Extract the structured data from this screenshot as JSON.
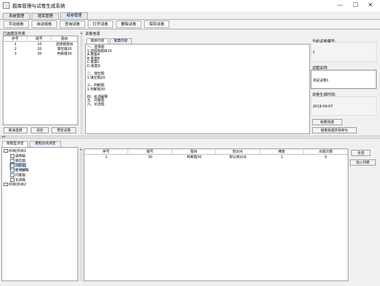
{
  "window": {
    "title": "题库管理与试卷生成系统",
    "minimize": "—",
    "maximize": "☐",
    "close": "✕"
  },
  "tabs": [
    "系统管理",
    "题库管理",
    "组卷管理"
  ],
  "toolbar": [
    "手动组卷",
    "自动组卷",
    "查询试卷",
    "打开试卷",
    "删除试卷",
    "保存试卷"
  ],
  "selected_panel": {
    "title": "已选题目列表",
    "headers": [
      "序号",
      "题号",
      "题目"
    ],
    "rows": [
      [
        "1",
        "10",
        "选择题题目"
      ],
      [
        "2",
        "20",
        "填空题20"
      ],
      [
        "3",
        "30",
        "判断题30"
      ]
    ],
    "buttons": [
      "取消选择",
      "清空",
      "预览试卷"
    ]
  },
  "paper_info": {
    "title": "试卷信息",
    "subtabs": [
      "题目内容",
      "答案内容"
    ],
    "content": [
      "一、选择题",
      "1.选择题题目10",
      "A.答案A",
      "B.答案B",
      "C.答案C",
      "D.答案D",
      "",
      "二、填空题",
      "1.填空题20",
      "",
      "三、判断题",
      "1.判断题30",
      "",
      "四、名词解释",
      "五、问答题",
      "六、论述题"
    ],
    "number_label": "当前试卷编号:",
    "number_value": "1",
    "name_label": "试题名称:",
    "name_value": "测试试卷1",
    "time_label": "试卷生成时间:",
    "time_value": "2019-09-07",
    "btn_complete": "组卷完成",
    "btn_complete_save": "组卷完成并另存为"
  },
  "bottom": {
    "subtabs": [
      "按题型浏览",
      "按知识点浏览"
    ],
    "tree": [
      {
        "label": "科目[科目1",
        "level": 0,
        "type": "folder"
      },
      {
        "label": "选择题",
        "level": 1,
        "type": "file"
      },
      {
        "label": "填空题",
        "level": 1,
        "type": "file"
      },
      {
        "label": "判断题",
        "level": 1,
        "type": "file",
        "selected": true
      },
      {
        "label": "名词解释",
        "level": 1,
        "type": "file"
      },
      {
        "label": "问答题",
        "level": 1,
        "type": "file"
      },
      {
        "label": "论述题",
        "level": 1,
        "type": "file"
      },
      {
        "label": "科目[科目2",
        "level": 0,
        "type": "folder"
      }
    ],
    "headers": [
      "序号",
      "题号",
      "题目",
      "知识点",
      "难度",
      "出题次数"
    ],
    "rows": [
      [
        "1",
        "30",
        "判断题30",
        "默认知识点",
        "1",
        "0"
      ]
    ],
    "buttons": [
      "全选",
      "加入列表"
    ]
  }
}
